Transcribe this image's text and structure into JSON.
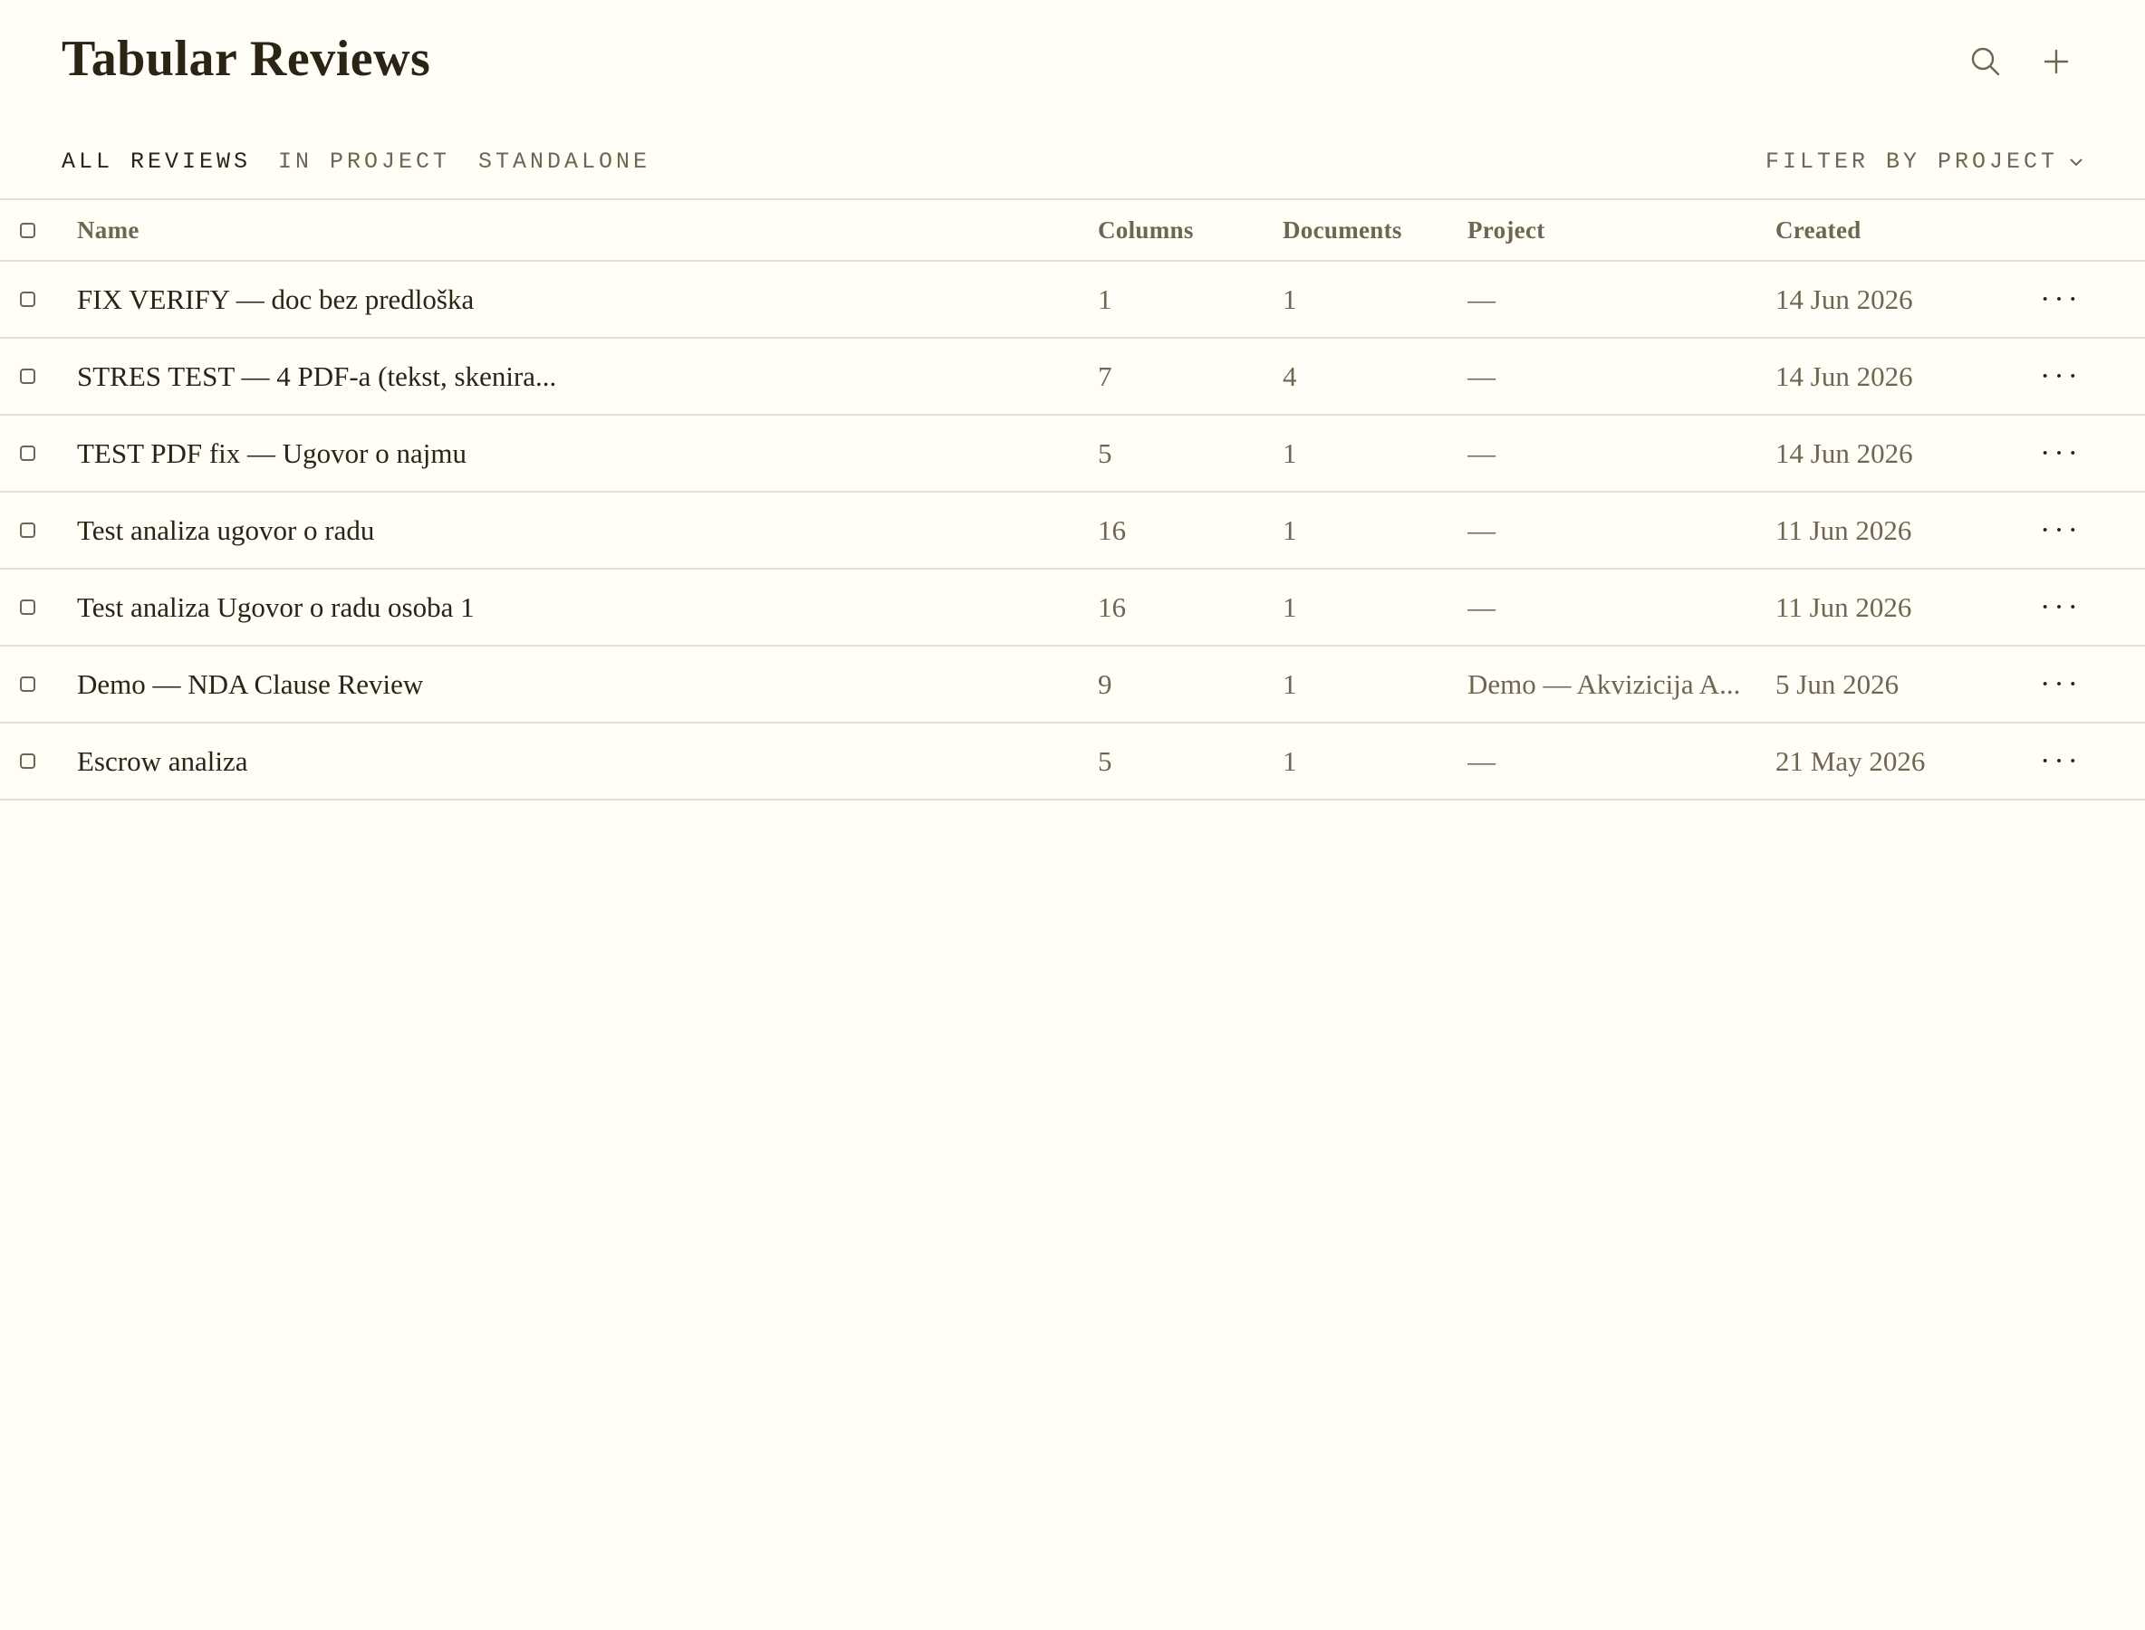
{
  "header": {
    "title": "Tabular Reviews",
    "search_icon": "search-icon",
    "add_icon": "plus-icon"
  },
  "tabs": [
    {
      "label": "ALL REVIEWS",
      "active": true
    },
    {
      "label": "IN PROJECT",
      "active": false
    },
    {
      "label": "STANDALONE",
      "active": false
    }
  ],
  "filter": {
    "label": "FILTER BY PROJECT",
    "icon": "chevron-down-icon"
  },
  "table": {
    "columns": {
      "name": "Name",
      "columns": "Columns",
      "documents": "Documents",
      "project": "Project",
      "created": "Created"
    },
    "rows": [
      {
        "name": "FIX VERIFY — doc bez predloška",
        "columns": "1",
        "documents": "1",
        "project": "—",
        "created": "14 Jun 2026",
        "more": "···"
      },
      {
        "name": "STRES TEST — 4 PDF-a (tekst, skenira...",
        "columns": "7",
        "documents": "4",
        "project": "—",
        "created": "14 Jun 2026",
        "more": "···"
      },
      {
        "name": "TEST PDF fix — Ugovor o najmu",
        "columns": "5",
        "documents": "1",
        "project": "—",
        "created": "14 Jun 2026",
        "more": "···"
      },
      {
        "name": "Test analiza ugovor o radu",
        "columns": "16",
        "documents": "1",
        "project": "—",
        "created": "11 Jun 2026",
        "more": "···"
      },
      {
        "name": "Test analiza Ugovor o radu osoba 1",
        "columns": "16",
        "documents": "1",
        "project": "—",
        "created": "11 Jun 2026",
        "more": "···"
      },
      {
        "name": "Demo — NDA Clause Review",
        "columns": "9",
        "documents": "1",
        "project": "Demo — Akvizicija A...",
        "created": "5 Jun 2026",
        "more": "···"
      },
      {
        "name": "Escrow analiza",
        "columns": "5",
        "documents": "1",
        "project": "—",
        "created": "21 May 2026",
        "more": "···"
      }
    ]
  },
  "colors": {
    "background": "#fffdf5",
    "text": "#2b2414",
    "muted": "#6e6650",
    "border": "#e3dfd3"
  }
}
